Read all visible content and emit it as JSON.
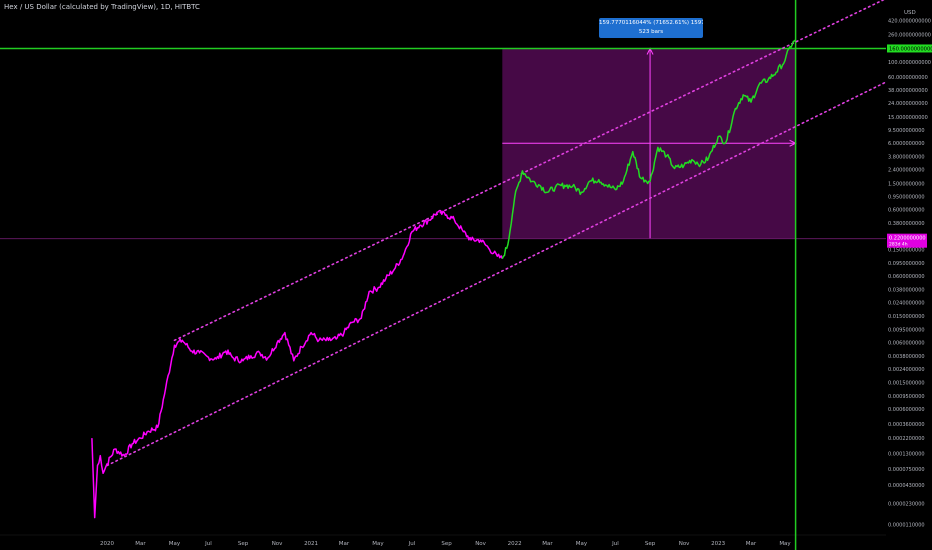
{
  "header": {
    "title": "Hex / US Dollar (calculated by TradingView), 1D, HITBTC"
  },
  "measure": {
    "line1": "159.7770116044% (71652.61%) 15977701160441",
    "line2": "523 bars"
  },
  "price_axis": {
    "currency": "USD",
    "ticks": [
      "420.0000000000",
      "260.0000000000",
      "160.0000000000",
      "100.0000000000",
      "60.0000000000",
      "38.0000000000",
      "24.0000000000",
      "15.0000000000",
      "9.5000000000",
      "6.0000000000",
      "3.8000000000",
      "2.4000000000",
      "1.5000000000",
      "0.9500000000",
      "0.6000000000",
      "0.3800000000",
      "0.2400000000",
      "0.1500000000",
      "0.0950000000",
      "0.0600000000",
      "0.0380000000",
      "0.0240000000",
      "0.0150000000",
      "0.0095000000",
      "0.0060000000",
      "0.0038000000",
      "0.0024000000",
      "0.0015000000",
      "0.0009500000",
      "0.0006000000",
      "0.0003600000",
      "0.0002200000",
      "0.0001300000",
      "0.0000750000",
      "0.0000430000",
      "0.0000230000",
      "0.0000110000"
    ],
    "current_label": "160.0000000000",
    "magenta_label": "0.2200000000",
    "magenta_sublabel": "283d 4h"
  },
  "time_axis": {
    "ticks": [
      "2020",
      "Mar",
      "May",
      "Jul",
      "Sep",
      "Nov",
      "2021",
      "Mar",
      "May",
      "Jul",
      "Sep",
      "Nov",
      "2022",
      "Mar",
      "May",
      "Jul",
      "Sep",
      "Nov",
      "2023",
      "Mar",
      "May"
    ]
  },
  "colors": {
    "background": "#000000",
    "line_early": "#ff00ff",
    "line_recent": "#22dd22",
    "channel": "#e040e0",
    "measure_box": "#4a0a4a",
    "measure_lines": "#ff44ff",
    "horizontal_green": "#22cc22",
    "info_box": "#1e6fd0"
  },
  "chart_data": {
    "type": "line",
    "title": "Hex / US Dollar (calculated by TradingView), 1D, HITBTC",
    "xlabel": "",
    "ylabel": "",
    "y_scale": "log",
    "ylim": [
      8.5e-06,
      650
    ],
    "series": [
      {
        "color": "#ff00ff",
        "x": [
          "2019-12-05",
          "2019-12-10",
          "2019-12-15",
          "2019-12-20",
          "2019-12-25",
          "2020-01-01",
          "2020-01-15",
          "2020-02-01",
          "2020-02-15",
          "2020-03-01",
          "2020-03-15",
          "2020-04-01",
          "2020-04-15",
          "2020-05-01",
          "2020-05-15",
          "2020-06-01",
          "2020-06-15",
          "2020-07-01",
          "2020-07-15",
          "2020-08-01",
          "2020-08-15",
          "2020-09-01",
          "2020-09-15",
          "2020-10-01",
          "2020-10-15",
          "2020-11-01",
          "2020-11-15",
          "2020-12-01",
          "2020-12-15",
          "2021-01-01",
          "2021-01-15",
          "2021-02-01",
          "2021-02-15",
          "2021-03-01",
          "2021-03-15",
          "2021-04-01",
          "2021-04-15",
          "2021-05-01",
          "2021-05-15",
          "2021-06-01",
          "2021-06-15",
          "2021-07-01",
          "2021-07-15",
          "2021-08-01",
          "2021-08-15",
          "2021-09-01",
          "2021-09-15",
          "2021-10-01",
          "2021-10-15",
          "2021-11-01",
          "2021-11-15",
          "2021-12-01",
          "2021-12-10"
        ],
        "y": [
          0.00022,
          1.4e-05,
          8.5e-05,
          0.00012,
          6.5e-05,
          9e-05,
          0.00015,
          0.00012,
          0.00018,
          0.00022,
          0.00028,
          0.00032,
          0.0012,
          0.0055,
          0.0065,
          0.0045,
          0.0042,
          0.0036,
          0.0034,
          0.0045,
          0.0035,
          0.0032,
          0.0038,
          0.0042,
          0.0035,
          0.006,
          0.0085,
          0.0032,
          0.0052,
          0.0085,
          0.0065,
          0.0065,
          0.0068,
          0.0085,
          0.012,
          0.014,
          0.035,
          0.04,
          0.055,
          0.08,
          0.12,
          0.28,
          0.35,
          0.42,
          0.55,
          0.5,
          0.42,
          0.28,
          0.21,
          0.21,
          0.16,
          0.12,
          0.11
        ]
      },
      {
        "color": "#22dd22",
        "x": [
          "2021-12-10",
          "2021-12-20",
          "2022-01-01",
          "2022-01-15",
          "2022-02-01",
          "2022-02-15",
          "2022-03-01",
          "2022-03-15",
          "2022-04-01",
          "2022-04-15",
          "2022-05-01",
          "2022-05-15",
          "2022-06-01",
          "2022-06-15",
          "2022-07-01",
          "2022-07-15",
          "2022-08-01",
          "2022-08-15",
          "2022-09-01",
          "2022-09-15",
          "2022-10-01",
          "2022-10-15",
          "2022-11-01",
          "2022-11-15",
          "2022-12-01",
          "2022-12-15",
          "2023-01-01",
          "2023-01-15",
          "2023-02-01",
          "2023-02-15",
          "2023-03-01",
          "2023-03-15",
          "2023-04-01",
          "2023-04-15",
          "2023-05-01",
          "2023-05-10",
          "2023-05-20"
        ],
        "y": [
          0.11,
          0.18,
          0.9,
          2.3,
          1.6,
          1.4,
          1.1,
          1.3,
          1.4,
          1.35,
          1.1,
          1.6,
          1.7,
          1.4,
          1.2,
          1.6,
          4.5,
          1.8,
          1.6,
          5.2,
          3.9,
          2.5,
          2.8,
          3.4,
          2.9,
          3.6,
          7.5,
          6.2,
          20,
          32,
          25,
          45,
          55,
          70,
          105,
          170,
          215
        ]
      }
    ],
    "annotations": [
      "Ascending channel (two dotted parallel lines)",
      "Price range measurement box"
    ],
    "legend": "none"
  }
}
